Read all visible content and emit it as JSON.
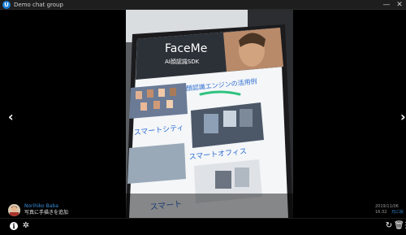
{
  "window": {
    "title": "Demo chat group",
    "app_icon_letter": "U",
    "minimize_glyph": "—",
    "close_glyph": "✕"
  },
  "viewer": {
    "prev_glyph": "‹",
    "next_glyph": "›",
    "photo_text": {
      "brand": "FaceMe",
      "subtitle": "AI顔認識SDK",
      "headline": "FaceMe® 顔認識エンジンの活用例",
      "section_city": "スマートシティ",
      "section_office": "スマートオフィス",
      "section_bottom": "スマート"
    }
  },
  "message": {
    "sender_name": "Norihiko Baba",
    "caption": "写真に手描きを追加",
    "timestamp": "2019/11/06 16:32",
    "accent_text": "元に戻"
  },
  "toolbar": {
    "info_glyph": "i",
    "settings_glyph": "✲",
    "rotate_glyph": "↻",
    "delete_glyph": "🗑",
    "more_glyph": "⋮"
  },
  "colors": {
    "accent": "#3a8fe0",
    "app_icon": "#1a7fd8",
    "drawing_stroke": "#2ec27e"
  }
}
